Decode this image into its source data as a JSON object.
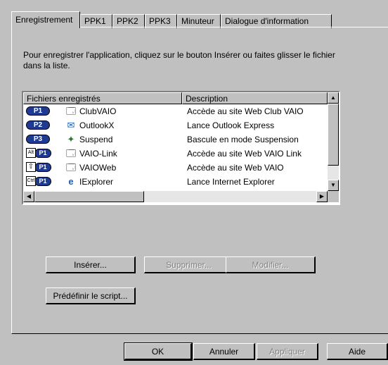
{
  "tabs": [
    {
      "label": "Enregistrement",
      "active": true
    },
    {
      "label": "PPK1",
      "active": false
    },
    {
      "label": "PPK2",
      "active": false
    },
    {
      "label": "PPK3",
      "active": false
    },
    {
      "label": "Minuteur",
      "active": false
    },
    {
      "label": "Dialogue d'information",
      "active": false
    }
  ],
  "instructions": "Pour enregistrer l'application, cliquez sur le bouton Insérer ou faites glisser le fichier dans la liste.",
  "list": {
    "columns": [
      "Fichiers enregistrés",
      "Description"
    ],
    "rows": [
      {
        "badge": "P1",
        "modifier": "",
        "icon": "application-icon",
        "name": "ClubVAIO",
        "description": "Accède au site Web Club VAIO"
      },
      {
        "badge": "P2",
        "modifier": "",
        "icon": "outlook-express-icon",
        "name": "OutlookX",
        "description": "Lance Outlook Express"
      },
      {
        "badge": "P3",
        "modifier": "",
        "icon": "suspend-icon",
        "name": "Suspend",
        "description": "Bascule en mode Suspension"
      },
      {
        "badge": "P1",
        "modifier": "Alt",
        "icon": "application-icon",
        "name": "VAIO-Link",
        "description": "Accède au site Web VAIO Link"
      },
      {
        "badge": "P1",
        "modifier": "Shift",
        "icon": "application-icon",
        "name": "VAIOWeb",
        "description": "Accède au site Web VAIO"
      },
      {
        "badge": "P1",
        "modifier": "Ctrl",
        "icon": "internet-explorer-icon",
        "name": "IExplorer",
        "description": "Lance Internet Explorer"
      }
    ]
  },
  "buttons": {
    "insert": "Insérer...",
    "delete": "Supprimer...",
    "modify": "Modifier...",
    "script": "Prédéfinir le script..."
  },
  "footer": {
    "ok": "OK",
    "cancel": "Annuler",
    "apply": "Appliquer",
    "help": "Aide"
  },
  "colors": {
    "face": "#c0c0c0",
    "badge": "#1f3a93"
  }
}
